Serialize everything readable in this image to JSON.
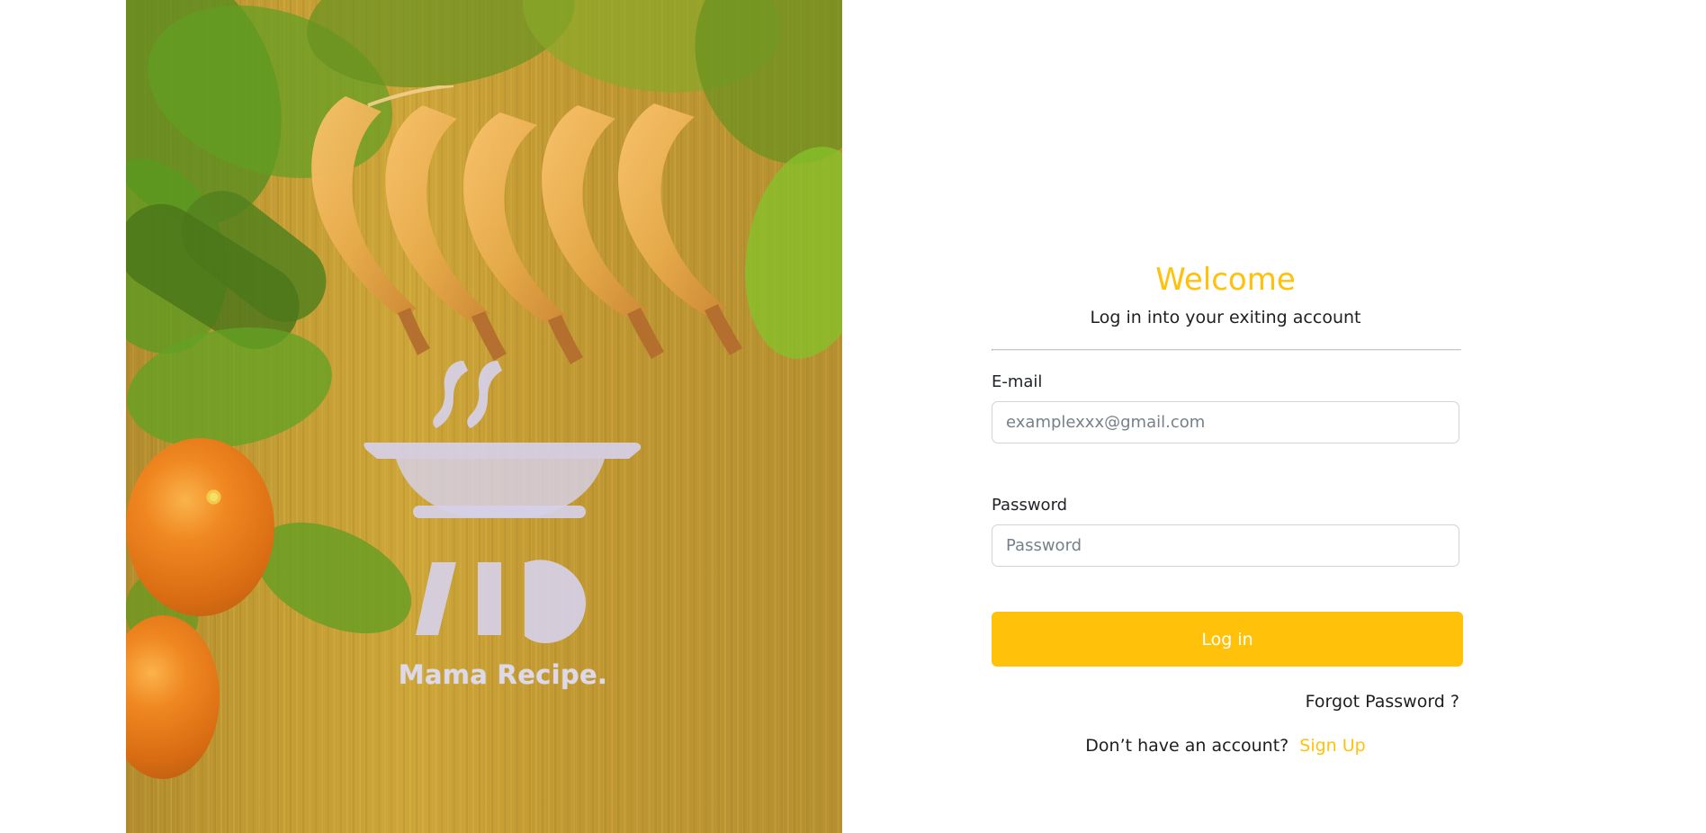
{
  "brand": {
    "name": "Mama Recipe."
  },
  "login": {
    "title": "Welcome",
    "subtitle": "Log in into your exiting account",
    "email": {
      "label": "E-mail",
      "value": "",
      "placeholder": "examplexxx@gmail.com"
    },
    "password": {
      "label": "Password",
      "value": "",
      "placeholder": "Password"
    },
    "submit_label": "Log in",
    "forgot_label": "Forgot Password ?",
    "signup_prompt": "Don’t have an account?",
    "signup_label": "Sign Up"
  },
  "colors": {
    "accent": "#FFC10A",
    "text": "#212529",
    "muted_text": "#5C636A",
    "input_border": "#CFD4DA",
    "white": "#FFFFFF"
  },
  "icons": {
    "brand_logo": "bbq-grill-icon"
  }
}
